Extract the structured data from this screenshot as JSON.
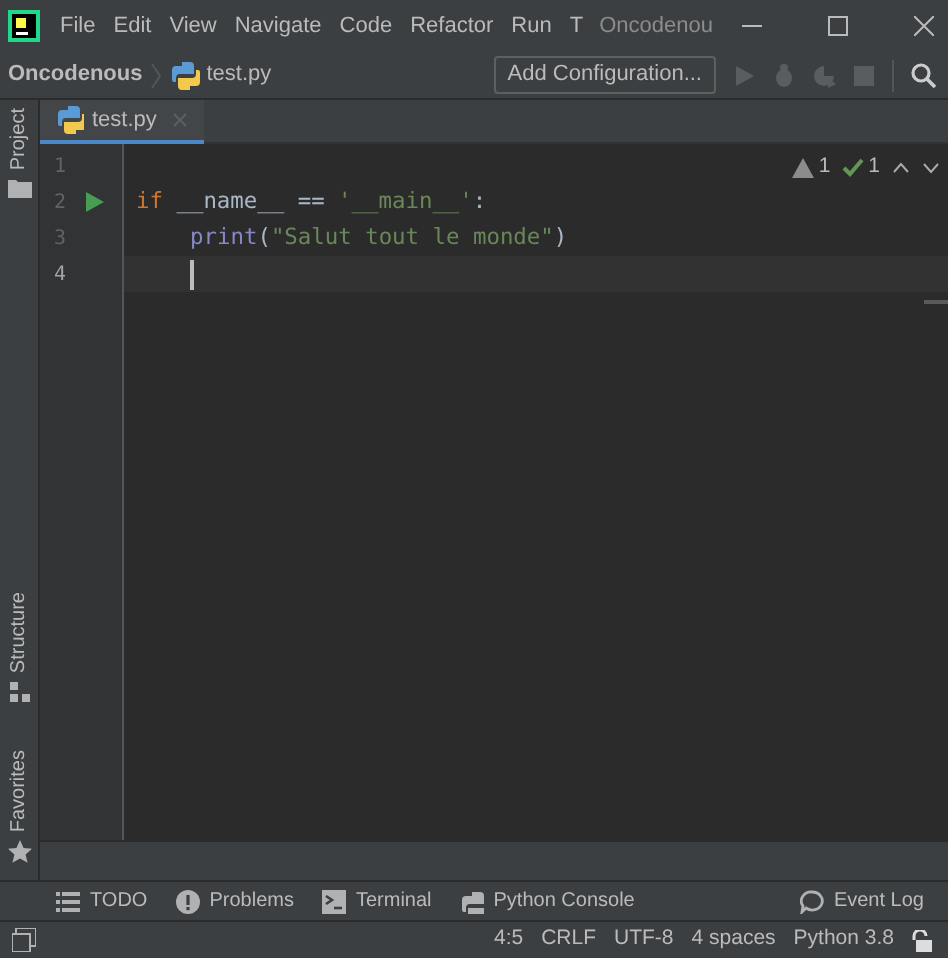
{
  "menu_bar": {
    "items": [
      "File",
      "Edit",
      "View",
      "Navigate",
      "Code",
      "Refactor",
      "Run",
      "T"
    ],
    "title": "Oncodenou"
  },
  "nav_bar": {
    "breadcrumbs": [
      "Oncodenous",
      "test.py"
    ],
    "configuration": "Add Configuration..."
  },
  "side_tools": {
    "top": [
      "Project"
    ],
    "bottom": [
      "Structure",
      "Favorites"
    ]
  },
  "tabs": [
    {
      "label": "test.py",
      "selected": true
    }
  ],
  "inspections": {
    "warnings": "1",
    "typos": "1"
  },
  "editor": {
    "lines": [
      {
        "number": "1",
        "runnable": false,
        "current": false
      },
      {
        "number": "2",
        "runnable": true,
        "current": false,
        "tokens": [
          {
            "text": "if ",
            "kind": "keyword"
          },
          {
            "text": "__name__ == ",
            "kind": "plain"
          },
          {
            "text": "'__main__'",
            "kind": "string"
          },
          {
            "text": ":",
            "kind": "plain"
          }
        ]
      },
      {
        "number": "3",
        "runnable": false,
        "current": false,
        "indent": true,
        "tokens": [
          {
            "text": "print",
            "kind": "builtin"
          },
          {
            "text": "(",
            "kind": "plain"
          },
          {
            "text": "\"Salut tout le monde\"",
            "kind": "string"
          },
          {
            "text": ")",
            "kind": "plain"
          }
        ]
      },
      {
        "number": "4",
        "runnable": false,
        "current": true,
        "indent": true
      }
    ]
  },
  "tool_windows": [
    "TODO",
    "Problems",
    "Terminal",
    "Python Console",
    "Event Log"
  ],
  "status_bar": [
    "4:5",
    "CRLF",
    "UTF-8",
    "4 spaces",
    "Python 3.8"
  ]
}
